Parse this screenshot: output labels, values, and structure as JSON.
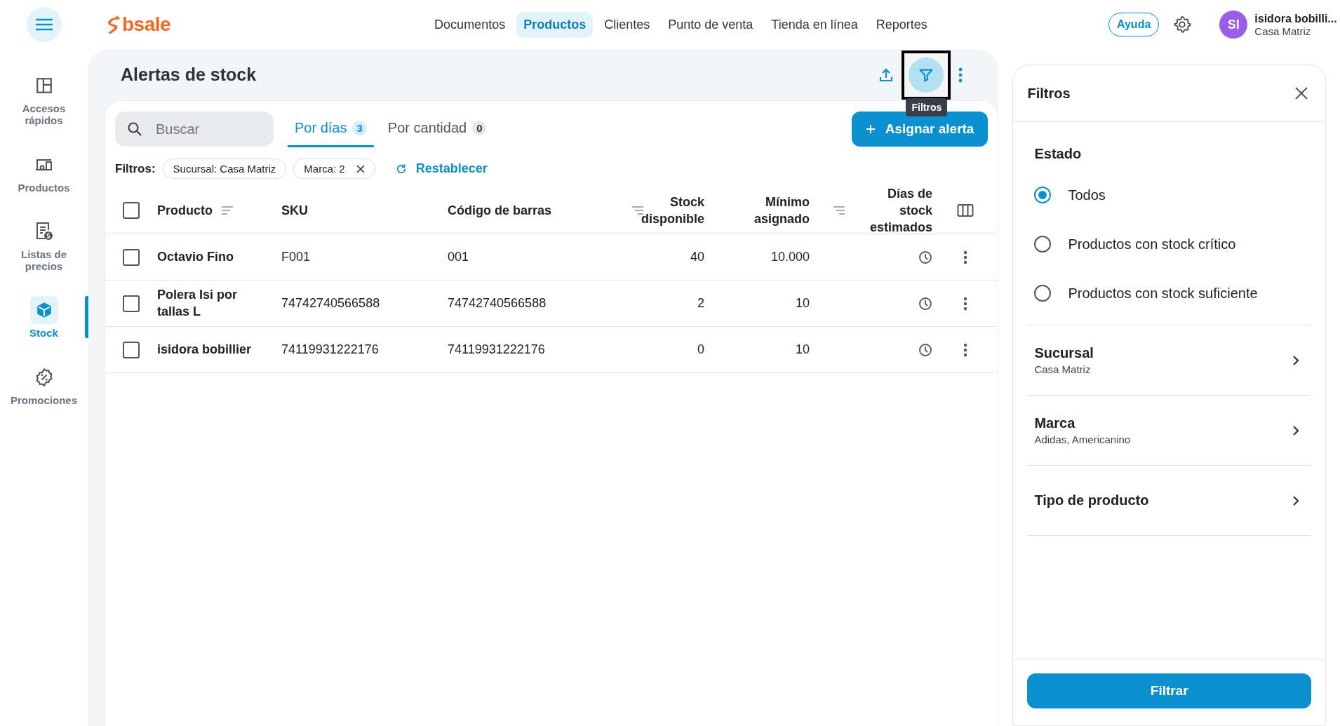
{
  "header": {
    "logo": "bsale",
    "nav": [
      {
        "label": "Documentos",
        "selected": false
      },
      {
        "label": "Productos",
        "selected": true
      },
      {
        "label": "Clientes",
        "selected": false
      },
      {
        "label": "Punto de venta",
        "selected": false
      },
      {
        "label": "Tienda en línea",
        "selected": false
      },
      {
        "label": "Reportes",
        "selected": false
      }
    ],
    "help": "Ayuda",
    "user": {
      "initials": "SI",
      "name": "isidora bobilli...",
      "branch": "Casa Matriz"
    }
  },
  "sidebar": {
    "items": [
      {
        "kind": "quick",
        "label": "Accesos rápidos",
        "selected": false
      },
      {
        "kind": "products",
        "label": "Productos",
        "selected": false
      },
      {
        "kind": "prices",
        "label": "Listas de precios",
        "selected": false
      },
      {
        "kind": "stock",
        "label": "Stock",
        "selected": true
      },
      {
        "kind": "promo",
        "label": "Promociones",
        "selected": false
      }
    ]
  },
  "page": {
    "title": "Alertas de stock",
    "tooltip": "Filtros",
    "search": {
      "placeholder": "Buscar"
    },
    "tabs": [
      {
        "label": "Por días",
        "count": "3",
        "selected": true
      },
      {
        "label": "Por cantidad",
        "count": "0",
        "selected": false
      }
    ],
    "primary_button": "Asignar alerta",
    "filters_label": "Filtros:",
    "chips": [
      {
        "label": "Sucursal: Casa Matriz",
        "removable": false
      },
      {
        "label": "Marca: 2",
        "removable": true
      }
    ],
    "reset": "Restablecer",
    "table": {
      "all_checked": false,
      "columns": [
        "Producto",
        "SKU",
        "Código de barras",
        "Stock disponible",
        "Mínimo asignado",
        "Días de stock estimados"
      ],
      "rows": [
        {
          "product": "Octavio Fino",
          "sku": "F001",
          "barcode": "001",
          "stock": "40",
          "minimum": "10.000",
          "checked": false
        },
        {
          "product": "Polera Isi por tallas L",
          "sku": "74742740566588",
          "barcode": "74742740566588",
          "stock": "2",
          "minimum": "10",
          "checked": false
        },
        {
          "product": "isidora bobillier",
          "sku": "74119931222176",
          "barcode": "74119931222176",
          "stock": "0",
          "minimum": "10",
          "checked": false
        }
      ]
    }
  },
  "filters_panel": {
    "title": "Filtros",
    "estado": {
      "title": "Estado",
      "options": [
        {
          "label": "Todos",
          "selected": true
        },
        {
          "label": "Productos con stock crítico",
          "selected": false
        },
        {
          "label": "Productos con stock suficiente",
          "selected": false
        }
      ]
    },
    "sections": [
      {
        "title": "Sucursal",
        "value": "Casa Matriz"
      },
      {
        "title": "Marca",
        "value": "Adidas, Americanino"
      },
      {
        "title": "Tipo de producto"
      }
    ],
    "button": "Filtrar"
  }
}
